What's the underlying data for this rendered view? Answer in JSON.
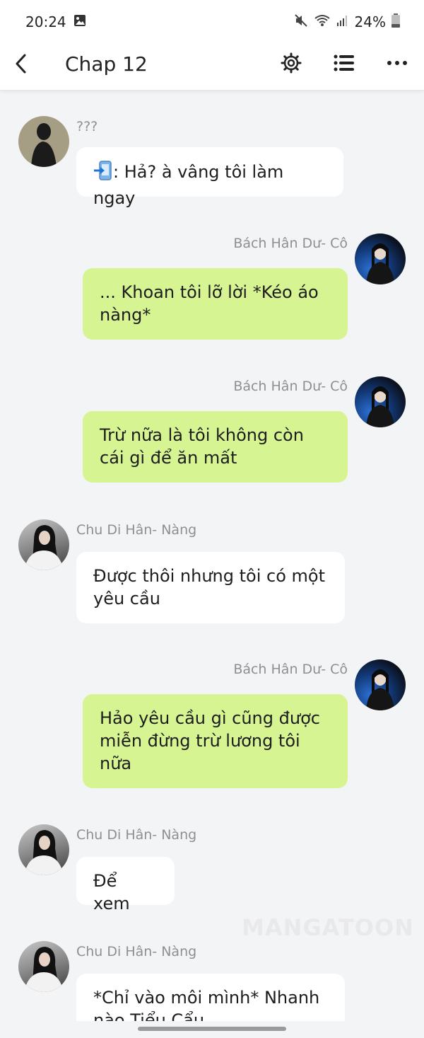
{
  "status_bar": {
    "time": "20:24",
    "battery": "24%",
    "icons": [
      "image-icon",
      "mute-icon",
      "wifi-icon",
      "signal-icon",
      "battery-icon"
    ]
  },
  "header": {
    "title": "Chap 12",
    "icons": [
      "back-icon",
      "gear-icon",
      "list-icon",
      "more-icon"
    ]
  },
  "messages": [
    {
      "side": "left",
      "sender": "???",
      "avatar": "mystery",
      "text": ": Hả? à vâng tôi làm ngay",
      "prefix_icon": "phone-transfer-icon"
    },
    {
      "side": "right",
      "sender": "Bách Hân Dư- Cô",
      "avatar": "bach",
      "text": "... Khoan tôi lỡ lời *Kéo áo nàng*"
    },
    {
      "side": "right",
      "sender": "Bách Hân Dư- Cô",
      "avatar": "bach",
      "text": "Trừ nữa là tôi không còn cái gì để ăn mất"
    },
    {
      "side": "left",
      "sender": "Chu Di Hân- Nàng",
      "avatar": "chu",
      "text": "Được thôi nhưng tôi có một yêu cầu"
    },
    {
      "side": "right",
      "sender": "Bách Hân Dư- Cô",
      "avatar": "bach",
      "text": "Hảo yêu cầu gì cũng được miễn đừng trừ lương tôi nữa"
    },
    {
      "side": "left",
      "sender": "Chu Di Hân- Nàng",
      "avatar": "chu",
      "text": "Để xem"
    },
    {
      "side": "left",
      "sender": "Chu Di Hân- Nàng",
      "avatar": "chu",
      "text": "*Chỉ vào môi mình* Nhanh nào Tiểu Cẩu"
    }
  ],
  "watermark": "MANGATOON",
  "colors": {
    "background": "#f3f4f6",
    "bubble_left": "#ffffff",
    "bubble_right": "#d7f493",
    "name": "#8f8f8f"
  }
}
